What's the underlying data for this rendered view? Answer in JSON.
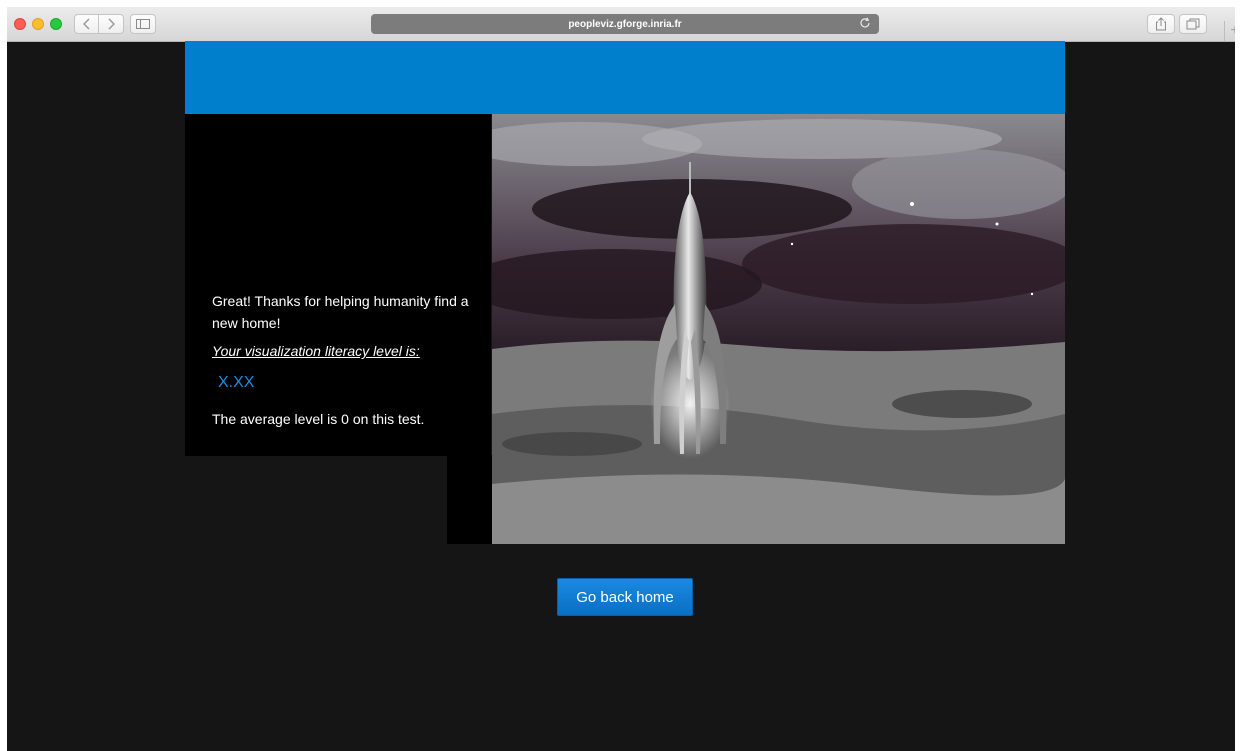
{
  "browser": {
    "url": "peopleviz.gforge.inria.fr"
  },
  "icons": {
    "back": "chevron-left-icon",
    "forward": "chevron-right-icon",
    "sidebar": "sidebar-icon",
    "reload": "reload-icon",
    "share": "share-icon",
    "tabs": "tabs-icon",
    "new_tab": "plus-icon"
  },
  "colors": {
    "header_blue": "#0080cc",
    "button_blue": "#0a76cf",
    "level_blue": "#1a8ee6",
    "page_background": "#151515"
  },
  "result": {
    "message": "Great! Thanks for helping humanity find a new home!",
    "literacy_label": "Your visualization literacy level is:",
    "level_value": "X.XX",
    "average_text": "The average level is 0 on this test."
  },
  "actions": {
    "go_back_home": "Go back home"
  }
}
